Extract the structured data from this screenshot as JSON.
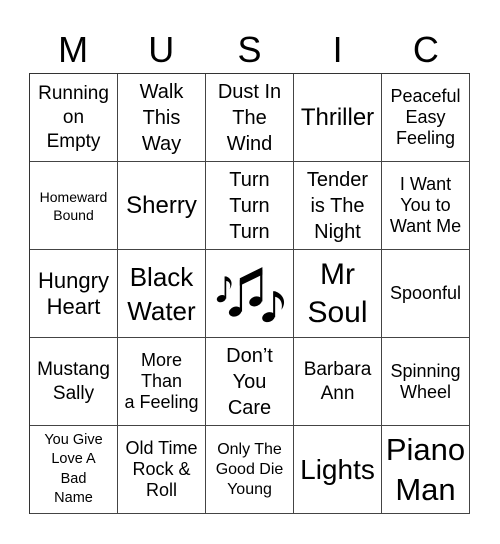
{
  "header": {
    "letters": [
      "M",
      "U",
      "S",
      "I",
      "C"
    ]
  },
  "cells": [
    {
      "text": "Running\non\nEmpty"
    },
    {
      "text": "Walk\nThis\nWay"
    },
    {
      "text": "Dust In\nThe\nWind"
    },
    {
      "text": "Thriller"
    },
    {
      "text": "Peaceful\nEasy\nFeeling"
    },
    {
      "text": "Homeward\nBound"
    },
    {
      "text": "Sherry"
    },
    {
      "text": "Turn\nTurn\nTurn"
    },
    {
      "text": "Tender\nis The\nNight"
    },
    {
      "text": "I Want\nYou to\nWant Me"
    },
    {
      "text": "Hungry\nHeart"
    },
    {
      "text": "Black\nWater"
    },
    {
      "text": "",
      "icon": "music-notes-icon",
      "free": true
    },
    {
      "text": "Mr\nSoul"
    },
    {
      "text": "Spoonful"
    },
    {
      "text": "Mustang\nSally"
    },
    {
      "text": "More\nThan\na Feeling"
    },
    {
      "text": "Don’t\nYou\nCare"
    },
    {
      "text": "Barbara\nAnn"
    },
    {
      "text": "Spinning\nWheel"
    },
    {
      "text": "You Give\nLove A\nBad\nName"
    },
    {
      "text": "Old Time\nRock &\nRoll"
    },
    {
      "text": "Only The\nGood Die\nYoung"
    },
    {
      "text": "Lights"
    },
    {
      "text": "Piano\nMan"
    }
  ]
}
